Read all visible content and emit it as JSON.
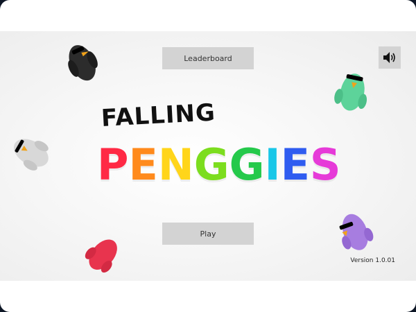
{
  "buttons": {
    "leaderboard_label": "Leaderboard",
    "play_label": "Play"
  },
  "title": {
    "line1": "FALLING",
    "line2_letters": [
      {
        "char": "P",
        "color": "#ff2a45"
      },
      {
        "char": "E",
        "color": "#ff8a1c"
      },
      {
        "char": "N",
        "color": "#ffd51a"
      },
      {
        "char": "G",
        "color": "#7cdd1e"
      },
      {
        "char": "G",
        "color": "#25c94b"
      },
      {
        "char": "I",
        "color": "#19c7e8"
      },
      {
        "char": "E",
        "color": "#2f5cf0"
      },
      {
        "char": "S",
        "color": "#e63ad8"
      }
    ]
  },
  "sound_icon": "speaker-icon",
  "version": "Version 1.0.01",
  "characters": [
    {
      "name": "black-penguin",
      "color": "#2c2c2c"
    },
    {
      "name": "white-penguin",
      "color": "#d8d8d8"
    },
    {
      "name": "red-penguin",
      "color": "#e8344e"
    },
    {
      "name": "green-penguin",
      "color": "#5dd39a"
    },
    {
      "name": "purple-penguin",
      "color": "#a77de0"
    }
  ],
  "colors": {
    "button_bg": "#d3d3d3",
    "background": "#f4f4f4"
  }
}
